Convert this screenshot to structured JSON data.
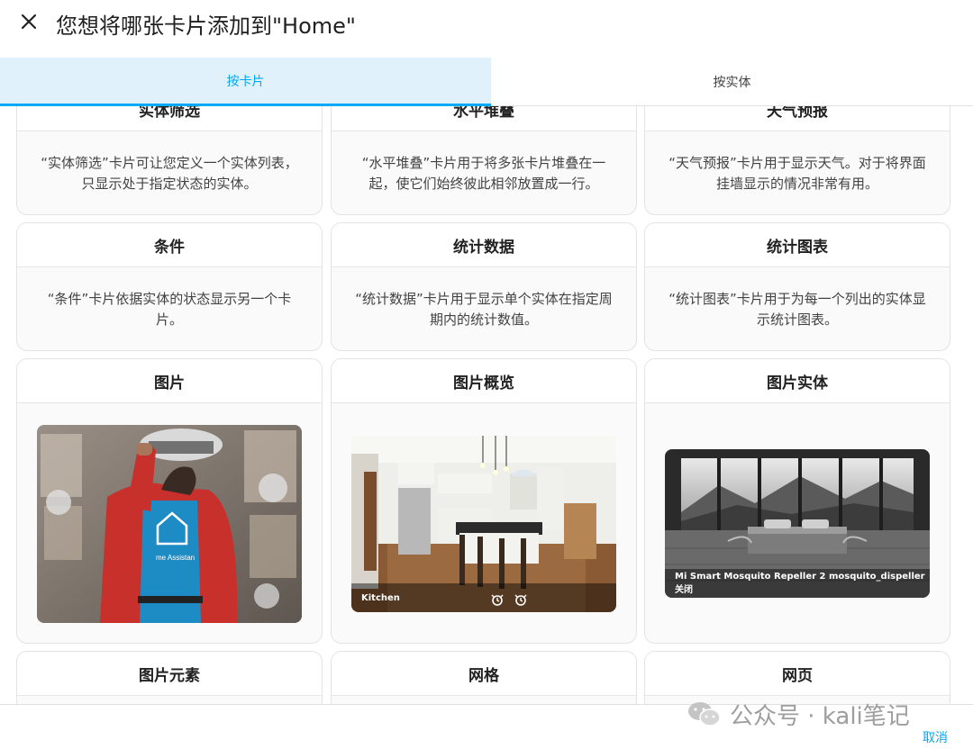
{
  "dialog": {
    "title": "您想将哪张卡片添加到\"Home\"",
    "close_icon": "close-icon"
  },
  "tabs": [
    {
      "label": "按卡片",
      "active": true
    },
    {
      "label": "按实体",
      "active": false
    }
  ],
  "cards": [
    {
      "title": "实体筛选",
      "description": "“实体筛选”卡片可让您定义一个实体列表，只显示处于指定状态的实体。"
    },
    {
      "title": "水平堆叠",
      "description": "“水平堆叠”卡片用于将多张卡片堆叠在一起，使它们始终彼此相邻放置成一行。"
    },
    {
      "title": "天气预报",
      "description": "“天气预报”卡片用于显示天气。对于将界面挂墙显示的情况非常有用。"
    },
    {
      "title": "条件",
      "description": "“条件”卡片依据实体的状态显示另一个卡片。"
    },
    {
      "title": "统计数据",
      "description": "“统计数据”卡片用于显示单个实体在指定周期内的统计数值。"
    },
    {
      "title": "统计图表",
      "description": "“统计图表”卡片用于为每一个列出的实体显示统计图表。"
    },
    {
      "title": "图片",
      "preview": "person-photo"
    },
    {
      "title": "图片概览",
      "preview": "kitchen-photo",
      "caption": "Kitchen"
    },
    {
      "title": "图片实体",
      "preview": "bedroom-photo",
      "caption": "Mi Smart Mosquito Repeller 2 mosquito_dispeller 关闭"
    },
    {
      "title": "图片元素"
    },
    {
      "title": "网格"
    },
    {
      "title": "网页"
    }
  ],
  "preview_shirt_text": "me Assistan",
  "footer": {
    "cancel_label": "取消",
    "watermark": "公众号 · kali笔记"
  },
  "colors": {
    "accent": "#03a9f4",
    "active_tab_bg": "#e0f1fb"
  }
}
